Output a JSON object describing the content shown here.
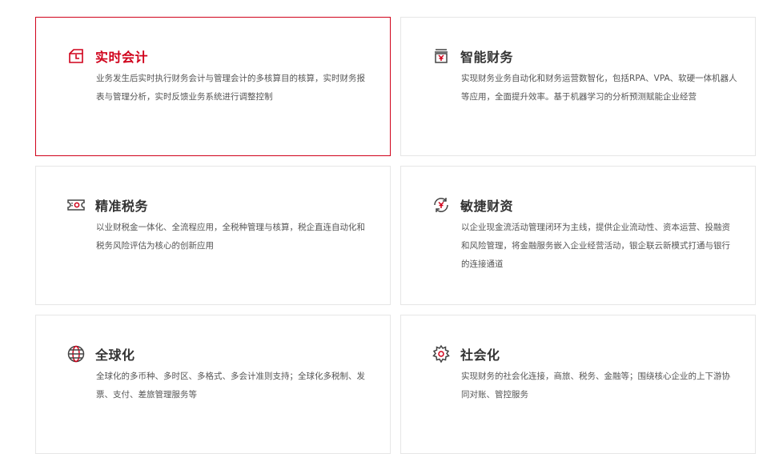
{
  "colors": {
    "accent": "#d0021b",
    "icon": "#444444",
    "title": "#333333",
    "text": "#555555",
    "border": "#e6e6e6"
  },
  "cards": [
    {
      "title": "实时会计",
      "icon": "calendar-clock-icon",
      "description": "业务发生后实时执行财务会计与管理会计的多核算目的核算，实时财务报表与管理分析，实时反馈业务系统进行调整控制",
      "active": true
    },
    {
      "title": "智能财务",
      "icon": "yen-register-icon",
      "description": "实现财务业务自动化和财务运营数智化，包括RPA、VPA、软硬一体机器人等应用，全面提升效率。基于机器学习的分析预测赋能企业经营",
      "active": false
    },
    {
      "title": "精准税务",
      "icon": "tax-ticket-icon",
      "description": "以业财税金一体化、全流程应用，全税种管理与核算，税企直连自动化和税务风险评估为核心的创新应用",
      "active": false
    },
    {
      "title": "敏捷财资",
      "icon": "yen-cycle-icon",
      "description": "以企业现金流活动管理闭环为主线，提供企业流动性、资本运营、投融资和风险管理，将金融服务嵌入企业经营活动，银企联云新模式打通与银行的连接通道",
      "active": false
    },
    {
      "title": "全球化",
      "icon": "globe-icon",
      "description": "全球化的多币种、多时区、多格式、多会计准则支持；全球化多税制、发票、支付、差旅管理服务等",
      "active": false
    },
    {
      "title": "社会化",
      "icon": "gear-network-icon",
      "description": "实现财务的社会化连接，商旅、税务、金融等；围绕核心企业的上下游协同对账、管控服务",
      "active": false
    }
  ]
}
